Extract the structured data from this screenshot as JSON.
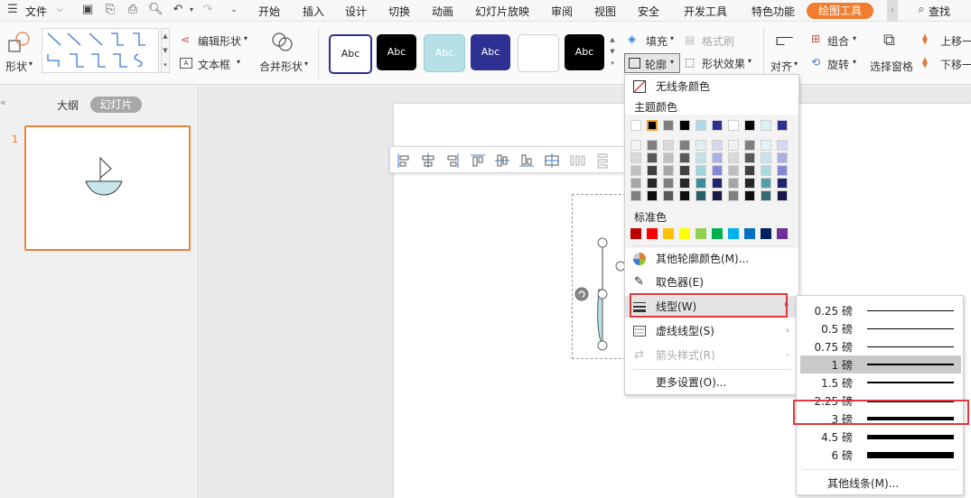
{
  "menubar": {
    "file": "文件",
    "tabs": [
      "开始",
      "插入",
      "设计",
      "切换",
      "动画",
      "幻灯片放映",
      "审阅",
      "视图",
      "安全",
      "开发工具",
      "特色功能"
    ],
    "active_tab": "绘图工具",
    "search": "查找"
  },
  "ribbon": {
    "shape_label": "形状",
    "edit_shape": "编辑形状",
    "textbox": "文本框",
    "merge_shape": "合并形状",
    "style_samples": [
      "Abc",
      "Abc",
      "Abc",
      "Abc",
      "",
      "Abc"
    ],
    "fill": "填充",
    "format_brush": "格式刷",
    "outline": "轮廓",
    "shape_effect": "形状效果",
    "align": "对齐",
    "group": "组合",
    "rotate": "旋转",
    "selection_pane": "选择窗格",
    "bring_up": "上移一",
    "send_down": "下移一"
  },
  "leftpanel": {
    "outline_tab": "大纲",
    "slides_tab": "幻灯片",
    "slide_number": "1"
  },
  "dropdown": {
    "no_line_color": "无线条颜色",
    "theme_colors": "主题颜色",
    "standard_colors": "标准色",
    "more_colors": "其他轮廓颜色(M)...",
    "eyedropper": "取色器(E)",
    "line_style": "线型(W)",
    "dash_style": "虚线线型(S)",
    "arrow_style": "箭头样式(R)",
    "more_settings": "更多设置(O)..."
  },
  "submenu": {
    "weights": [
      "0.25 磅",
      "0.5 磅",
      "0.75 磅",
      "1 磅",
      "1.5 磅",
      "2.25 磅",
      "3 磅",
      "4.5 磅",
      "6 磅"
    ],
    "selected": "1 磅",
    "more_lines": "其他线条(M)..."
  },
  "colors": {
    "accent": "#f07c2e",
    "highlight_box": "#e0383c",
    "theme_top": [
      "#ffffff",
      "#000000",
      "#7f7f7f",
      "#000000",
      "#add8e6",
      "#2e3192",
      "#ffffff",
      "#000000",
      "#dceff2",
      "#2e3192"
    ],
    "standard": [
      "#c00000",
      "#ff0000",
      "#ffc000",
      "#ffff00",
      "#92d050",
      "#00b050",
      "#00b0f0",
      "#0070c0",
      "#002060",
      "#7030a0"
    ]
  }
}
